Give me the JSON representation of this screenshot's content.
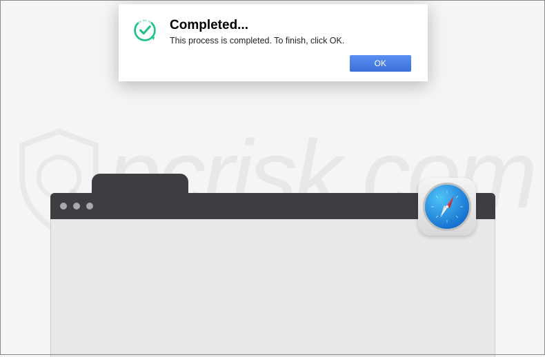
{
  "dialog": {
    "icon_name": "completed-check-icon",
    "title": "Completed...",
    "message": "This process is completed. To finish, click OK.",
    "ok_label": "OK"
  },
  "browser": {
    "icon_name": "safari-icon"
  },
  "watermark": {
    "text": "pcrisk.com"
  },
  "colors": {
    "dialog_accent": "#1fc18b",
    "button_bg": "#4a7fe8",
    "titlebar_bg": "#3d3e42",
    "safari_blue": "#1976d2"
  }
}
